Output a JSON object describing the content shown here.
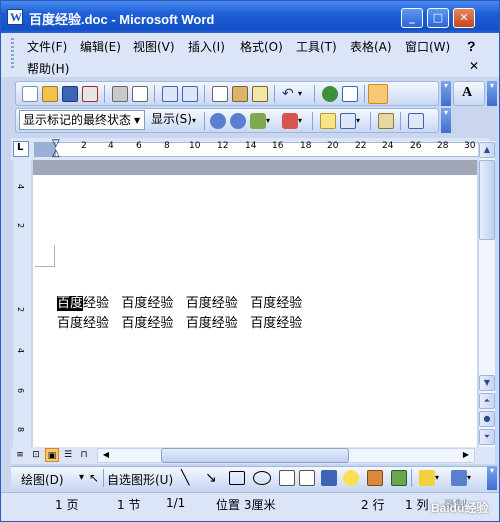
{
  "window": {
    "title": "百度经验.doc - Microsoft Word",
    "minimize_icon": "minimize-icon",
    "maximize_icon": "maximize-icon",
    "close_icon": "close-icon"
  },
  "menu": {
    "items": [
      "文件(F)",
      "编辑(E)",
      "视图(V)",
      "插入(I)",
      "格式(O)",
      "工具(T)",
      "表格(A)",
      "窗口(W)",
      "帮助(H)"
    ],
    "help_question": "?"
  },
  "formatting_toolbar": {
    "markup_dropdown": "显示标记的最终状态",
    "show_label": "显示(S)",
    "font_size_btn": "A"
  },
  "ruler": {
    "numbers": [
      "2",
      "4",
      "6",
      "8",
      "10",
      "12",
      "14",
      "16",
      "18",
      "20",
      "22",
      "24",
      "26",
      "28",
      "30"
    ],
    "vertical_numbers": [
      "4",
      "2",
      "2",
      "4",
      "6",
      "8"
    ]
  },
  "document": {
    "lines": [
      {
        "highlight": "百度",
        "rest": "经验   百度经验   百度经验   百度经验"
      },
      {
        "highlight": "",
        "rest": "百度经验   百度经验   百度经验   百度经验"
      }
    ]
  },
  "drawing_toolbar": {
    "draw_label": "绘图(D)",
    "autoshapes_label": "自选图形(U)"
  },
  "status": {
    "page": "1 页",
    "section": "1 节",
    "page_count": "1/1",
    "position": "位置 3厘米",
    "line": "2 行",
    "column": "1 列",
    "record": "录制",
    "watermark": "Baidu经验"
  }
}
